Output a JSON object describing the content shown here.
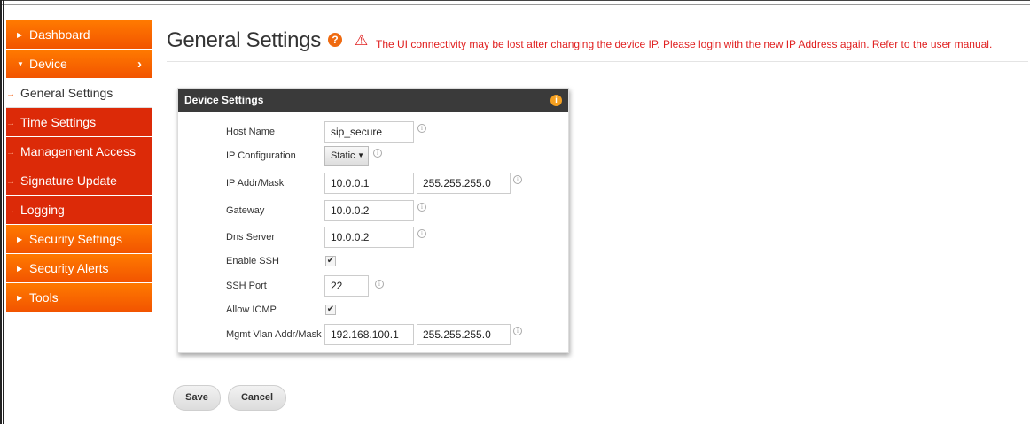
{
  "sidebar": {
    "dashboard": "Dashboard",
    "device": "Device",
    "general_settings": "General Settings",
    "time_settings": "Time Settings",
    "management_access": "Management Access",
    "signature_update": "Signature Update",
    "logging": "Logging",
    "security_settings": "Security Settings",
    "security_alerts": "Security Alerts",
    "tools": "Tools"
  },
  "header": {
    "title": "General Settings",
    "help_glyph": "?",
    "warning": "The UI connectivity may be lost after changing the device IP. Please login with the new IP Address again. Refer to the user manual."
  },
  "panel": {
    "title": "Device Settings",
    "info_glyph": "i",
    "host_name_label": "Host Name",
    "host_name_value": "sip_secure",
    "ip_config_label": "IP Configuration",
    "ip_config_value": "Static",
    "ip_addr_label": "IP Addr/Mask",
    "ip_addr_value": "10.0.0.1",
    "ip_mask_value": "255.255.255.0",
    "gateway_label": "Gateway",
    "gateway_value": "10.0.0.2",
    "dns_label": "Dns Server",
    "dns_value": "10.0.0.2",
    "enable_ssh_label": "Enable SSH",
    "enable_ssh_checked": true,
    "ssh_port_label": "SSH Port",
    "ssh_port_value": "22",
    "allow_icmp_label": "Allow ICMP",
    "allow_icmp_checked": true,
    "mgmt_vlan_label": "Mgmt Vlan Addr/Mask",
    "mgmt_vlan_addr": "192.168.100.1",
    "mgmt_vlan_mask": "255.255.255.0"
  },
  "buttons": {
    "save": "Save",
    "cancel": "Cancel"
  },
  "colors": {
    "accent_orange": "#f25400",
    "submenu_red": "#dc2a08",
    "warning_red": "#e02020",
    "panel_header": "#3a3a3a"
  },
  "icons": {
    "help": "question-circle-icon",
    "warning": "warning-triangle-icon",
    "field_info": "info-circle-icon",
    "checkbox": "checkmark-icon"
  }
}
